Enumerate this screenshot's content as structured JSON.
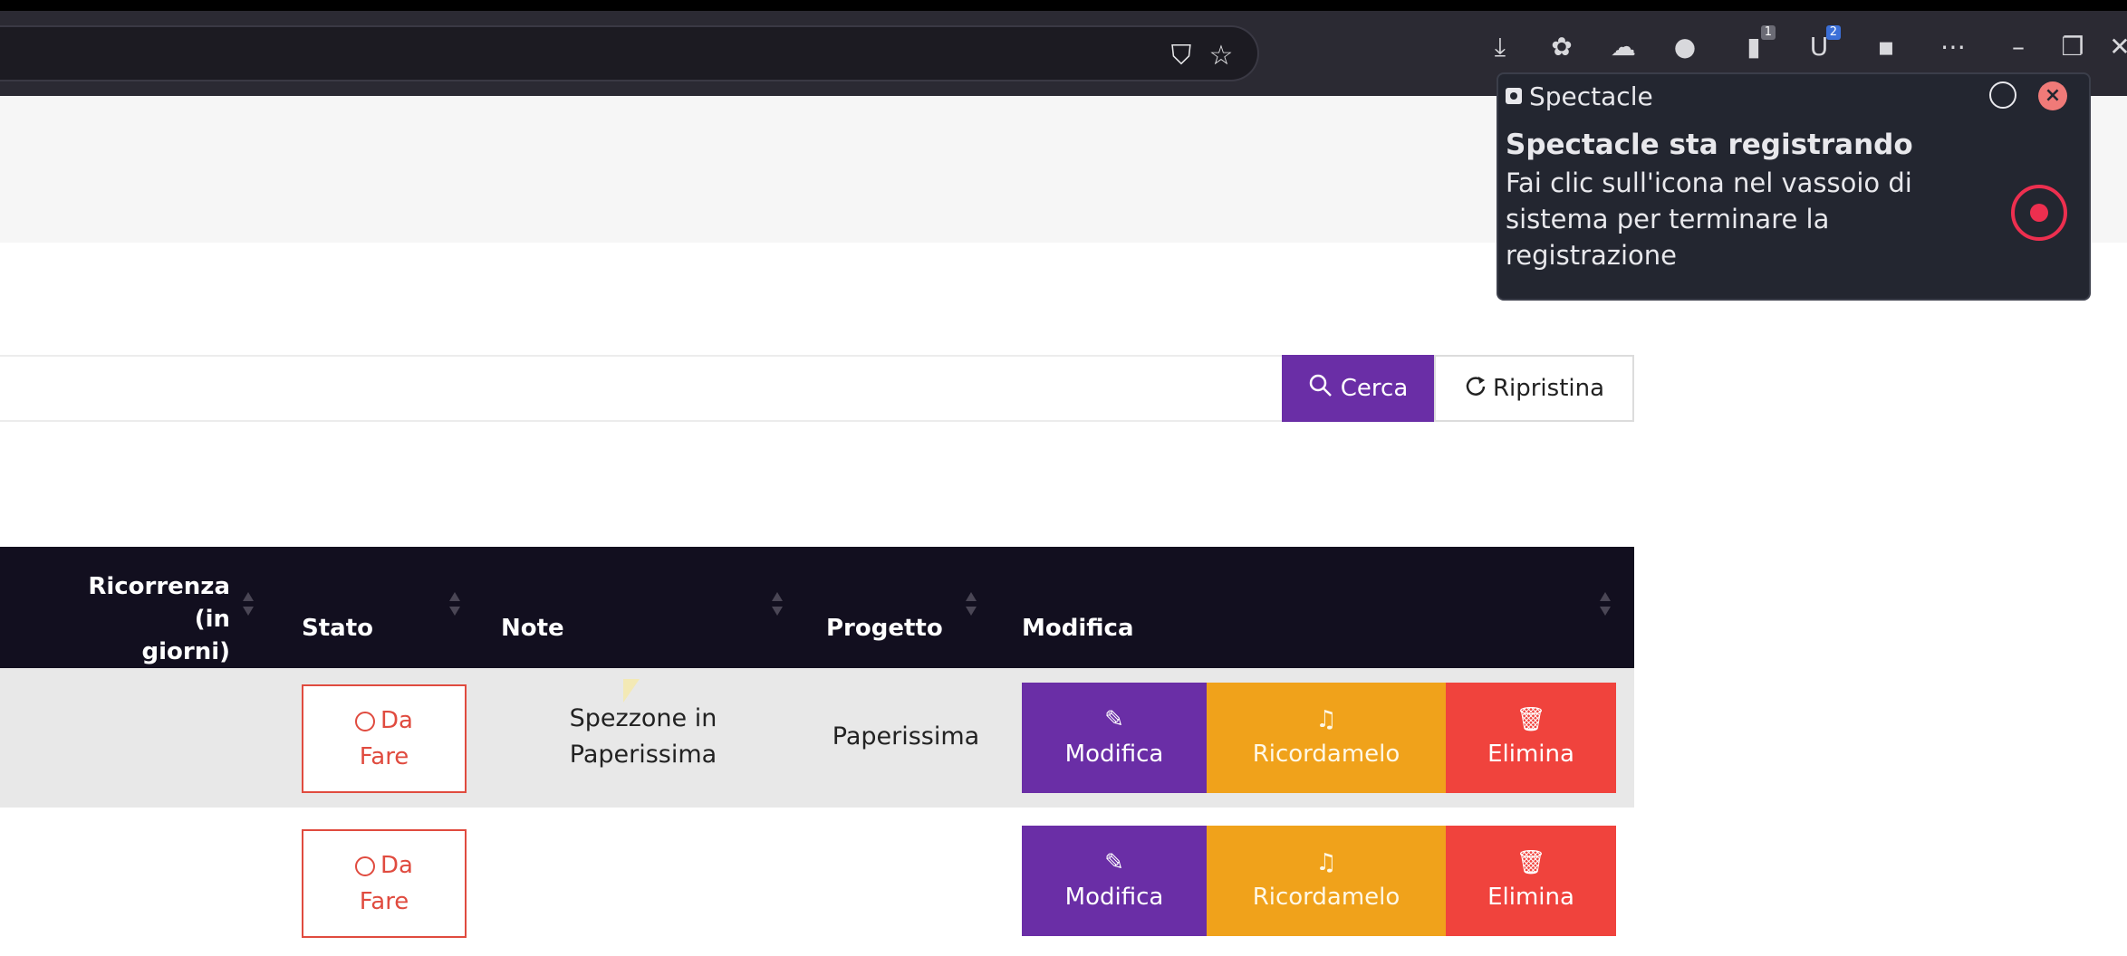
{
  "browser": {
    "url_actions": [
      "shield-icon",
      "star-icon"
    ],
    "toolbar_icons": [
      {
        "name": "download-icon",
        "glyph": "⤓"
      },
      {
        "name": "extensions-icon",
        "glyph": "✿"
      },
      {
        "name": "extension-icon",
        "glyph": "☁"
      },
      {
        "name": "extension-owl-icon",
        "glyph": "●"
      },
      {
        "name": "extension-badge-1-icon",
        "glyph": "▮",
        "badge": "1"
      },
      {
        "name": "extension-badge-2-icon",
        "glyph": "U",
        "badge": "2"
      },
      {
        "name": "trash-icon",
        "glyph": "▪"
      },
      {
        "name": "more-icon",
        "glyph": "⋯"
      },
      {
        "name": "minimize-icon",
        "glyph": "–"
      },
      {
        "name": "restore-icon",
        "glyph": "❐"
      },
      {
        "name": "close-window-icon",
        "glyph": "✕"
      }
    ]
  },
  "search": {
    "search_label": "Cerca",
    "reset_label": "Ripristina"
  },
  "table": {
    "headers": {
      "ricorrenza": [
        "Ricorrenza (in",
        "giorni)"
      ],
      "stato": "Stato",
      "note": "Note",
      "progetto": "Progetto",
      "modifica": "Modifica"
    },
    "rows": [
      {
        "stato": [
          "Da",
          "Fare"
        ],
        "note": [
          "Spezzone in",
          "Paperissima"
        ],
        "progetto": "Paperissima",
        "actions": {
          "edit": "Modifica",
          "remind": "Ricordamelo",
          "delete": "Elimina"
        }
      },
      {
        "stato": [
          "Da",
          "Fare"
        ],
        "note": [
          "",
          ""
        ],
        "progetto": "",
        "actions": {
          "edit": "Modifica",
          "remind": "Ricordamelo",
          "delete": "Elimina"
        }
      }
    ]
  },
  "notification": {
    "app_name": "Spectacle",
    "title": "Spectacle sta registrando",
    "body": "Fai clic sull'icona nel vassoio di sistema per terminare la registrazione",
    "colors": {
      "record": "#ed2f4f",
      "close": "#f07a78"
    }
  },
  "colors": {
    "primary": "#6a2ea6",
    "warning": "#f0a21b",
    "danger": "#f0433d",
    "table_header": "#120f1f",
    "status_todo": "#e04b3f"
  }
}
